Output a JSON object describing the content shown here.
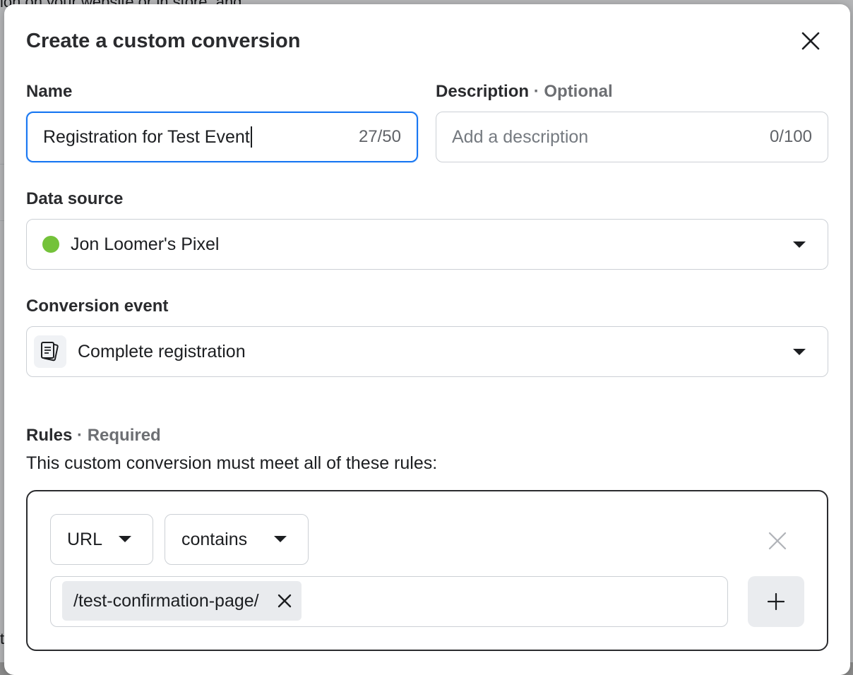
{
  "background": {
    "text_fragment": "ion on your website or in store, and",
    "letter": "t"
  },
  "dialog": {
    "title": "Create a custom conversion"
  },
  "name_field": {
    "label": "Name",
    "value": "Registration for Test Event",
    "counter": "27/50"
  },
  "description_field": {
    "label": "Description",
    "label_suffix": "· Optional",
    "placeholder": "Add a description",
    "counter": "0/100"
  },
  "data_source": {
    "label": "Data source",
    "value": "Jon Loomer's Pixel",
    "status_color": "#74c23a"
  },
  "conversion_event": {
    "label": "Conversion event",
    "value": "Complete registration",
    "icon": "document-stack-icon"
  },
  "rules": {
    "label": "Rules",
    "label_suffix": "· Required",
    "description": "This custom conversion must meet all of these rules:",
    "field_select": "URL",
    "operator_select": "contains",
    "tokens": [
      "/test-confirmation-page/"
    ]
  },
  "colors": {
    "focus_accent": "#1877f2"
  }
}
